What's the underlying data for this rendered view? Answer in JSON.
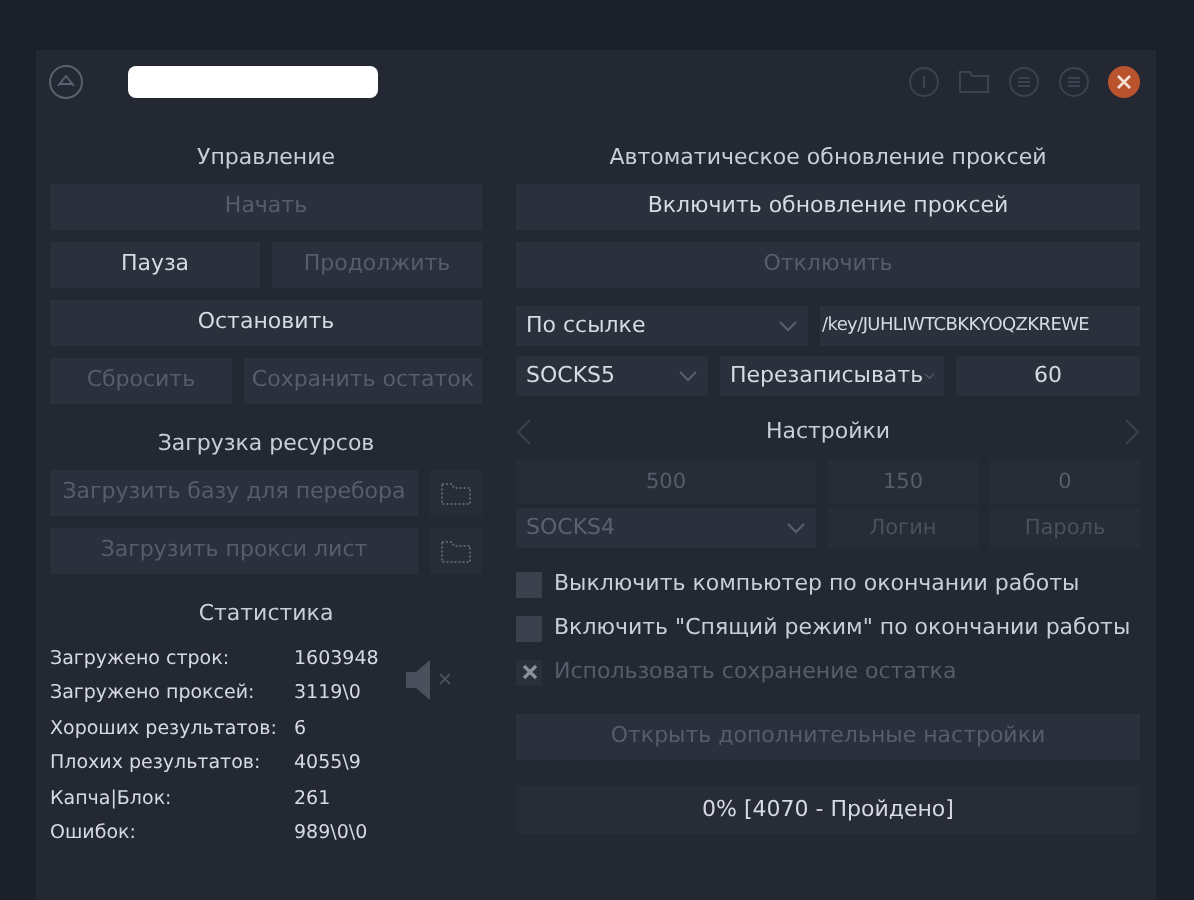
{
  "control": {
    "title": "Управление",
    "buttons": [
      {
        "label": "Начать",
        "disabled": true
      },
      {
        "label": "Пауза",
        "disabled": false
      },
      {
        "label": "Продолжить",
        "disabled": true
      },
      {
        "label": "Остановить",
        "disabled": false
      },
      {
        "label": "Сбросить",
        "disabled": true
      },
      {
        "label": "Сохранить остаток",
        "disabled": true
      }
    ]
  },
  "resources": {
    "title": "Загрузка ресурсов",
    "buttons": [
      {
        "label": "Загрузить базу для перебора",
        "disabled": true
      },
      {
        "label": "Загрузить прокси лист",
        "disabled": true
      }
    ]
  },
  "stats": {
    "title": "Статистика",
    "muted": true,
    "rows": [
      {
        "label": "Загружено строк:",
        "value": "1603948"
      },
      {
        "label": "Загружено проксей:",
        "value": "3119\\0"
      },
      {
        "label": "Хороших результатов:",
        "value": "6"
      },
      {
        "label": "Плохих результатов:",
        "value": "4055\\9"
      },
      {
        "label": "Капча|Блок:",
        "value": "261"
      },
      {
        "label": "Ошибок:",
        "value": "989\\0\\0"
      }
    ]
  },
  "proxy_update": {
    "title": "Автоматическое обновление проксей",
    "buttons": [
      {
        "label": "Включить обновление проксей",
        "disabled": false
      },
      {
        "label": "Отключить",
        "disabled": true
      }
    ],
    "source": "По ссылке",
    "url": "/key/JUHLIWTCBKKYOQZKREWE",
    "type": "SOCKS5",
    "mode": "Перезаписывать",
    "interval": "60"
  },
  "settings": {
    "title": "Настройки",
    "fields": [
      "500",
      "150",
      "0"
    ],
    "proxy_type": "SOCKS4",
    "login_placeholder": "Логин",
    "password_placeholder": "Пароль"
  },
  "options": [
    {
      "label": "Выключить компьютер по окончании работы",
      "checked": false,
      "disabled": false
    },
    {
      "label": "Включить \"Спящий режим\" по окончании работы",
      "checked": false,
      "disabled": false
    },
    {
      "label": "Использовать сохранение остатка",
      "checked": true,
      "disabled": true
    }
  ],
  "more_settings": {
    "label": "Открыть дополнительные настройки",
    "disabled": true
  },
  "progress": {
    "label": "0% [4070 - Пройдено]",
    "level": 0
  }
}
